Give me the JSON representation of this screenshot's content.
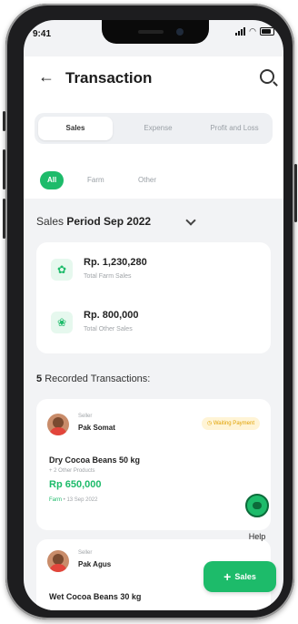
{
  "status": {
    "time": "9:41"
  },
  "header": {
    "title": "Transaction"
  },
  "tabs": [
    {
      "label": "Sales",
      "active": true
    },
    {
      "label": "Expense",
      "active": false
    },
    {
      "label": "Profit and Loss",
      "active": false
    }
  ],
  "filters": [
    {
      "label": "All",
      "active": true
    },
    {
      "label": "Farm",
      "active": false
    },
    {
      "label": "Other",
      "active": false
    }
  ],
  "period": {
    "prefix": "Sales",
    "value": "Period Sep 2022"
  },
  "summary": [
    {
      "amount": "Rp. 1,230,280",
      "label": "Total Farm Sales",
      "icon": "leaf-icon"
    },
    {
      "amount": "Rp. 800,000",
      "label": "Total Other Sales",
      "icon": "sprout-icon"
    }
  ],
  "recorded": {
    "count": "5",
    "label": "Recorded Transactions:"
  },
  "transactions": [
    {
      "seller_role": "Seller",
      "seller_name": "Pak Somat",
      "badge": "Waiting Payment",
      "product": "Dry Cocoa Beans 50 kg",
      "others": "+ 2 Other Products",
      "price": "Rp 650,000",
      "category": "Farm",
      "date": "13 Sep 2022"
    },
    {
      "seller_role": "Seller",
      "seller_name": "Pak Agus",
      "product": "Wet Cocoa Beans 30 kg"
    }
  ],
  "help": {
    "label": "Help"
  },
  "fab": {
    "label": "Sales"
  },
  "colors": {
    "accent": "#1dbb6a",
    "warning": "#e0a100"
  }
}
